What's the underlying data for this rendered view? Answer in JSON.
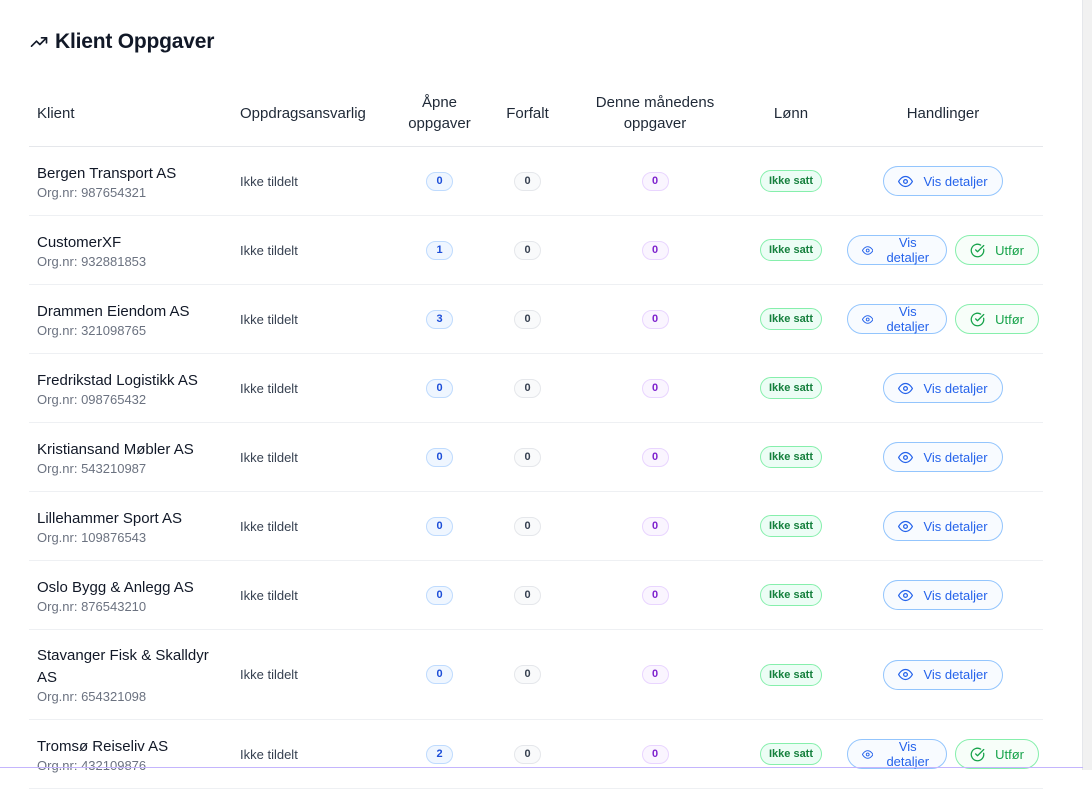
{
  "title": "Klient Oppgaver",
  "columns": {
    "client": "Klient",
    "responsible": "Oppdragsansvarlig",
    "open_tasks": "Åpne oppgaver",
    "overdue": "Forfalt",
    "this_month": "Denne månedens oppgaver",
    "salary": "Lønn",
    "actions": "Handlinger"
  },
  "view_label": "Vis detaljer",
  "complete_label": "Utfør",
  "colors": {
    "accent": "#2563eb",
    "success": "#16a34a",
    "purple": "#7e22ce"
  },
  "rows": [
    {
      "name": "Bergen Transport AS",
      "org": "Org.nr: 987654321",
      "responsible": "Ikke tildelt",
      "open": "0",
      "overdue": "0",
      "month": "0",
      "salary": "Ikke satt",
      "complete": false
    },
    {
      "name": "CustomerXF",
      "org": "Org.nr: 932881853",
      "responsible": "Ikke tildelt",
      "open": "1",
      "overdue": "0",
      "month": "0",
      "salary": "Ikke satt",
      "complete": true
    },
    {
      "name": "Drammen Eiendom AS",
      "org": "Org.nr: 321098765",
      "responsible": "Ikke tildelt",
      "open": "3",
      "overdue": "0",
      "month": "0",
      "salary": "Ikke satt",
      "complete": true
    },
    {
      "name": "Fredrikstad Logistikk AS",
      "org": "Org.nr: 098765432",
      "responsible": "Ikke tildelt",
      "open": "0",
      "overdue": "0",
      "month": "0",
      "salary": "Ikke satt",
      "complete": false
    },
    {
      "name": "Kristiansand Møbler AS",
      "org": "Org.nr: 543210987",
      "responsible": "Ikke tildelt",
      "open": "0",
      "overdue": "0",
      "month": "0",
      "salary": "Ikke satt",
      "complete": false
    },
    {
      "name": "Lillehammer Sport AS",
      "org": "Org.nr: 109876543",
      "responsible": "Ikke tildelt",
      "open": "0",
      "overdue": "0",
      "month": "0",
      "salary": "Ikke satt",
      "complete": false
    },
    {
      "name": "Oslo Bygg & Anlegg AS",
      "org": "Org.nr: 876543210",
      "responsible": "Ikke tildelt",
      "open": "0",
      "overdue": "0",
      "month": "0",
      "salary": "Ikke satt",
      "complete": false
    },
    {
      "name": "Stavanger Fisk & Skalldyr AS",
      "org": "Org.nr: 654321098",
      "responsible": "Ikke tildelt",
      "open": "0",
      "overdue": "0",
      "month": "0",
      "salary": "Ikke satt",
      "complete": false
    },
    {
      "name": "Tromsø Reiseliv AS",
      "org": "Org.nr: 432109876",
      "responsible": "Ikke tildelt",
      "open": "2",
      "overdue": "0",
      "month": "0",
      "salary": "Ikke satt",
      "complete": true
    }
  ]
}
